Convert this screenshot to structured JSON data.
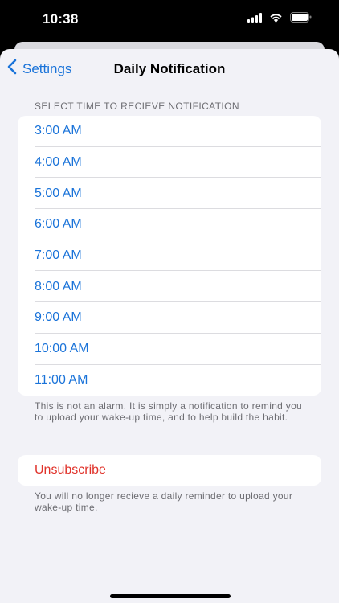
{
  "status_bar": {
    "time": "10:38",
    "icons": [
      "signal-icon",
      "wifi-icon",
      "battery-icon"
    ]
  },
  "nav": {
    "back_label": "Settings",
    "title": "Daily Notification"
  },
  "section_header": "SELECT TIME TO RECIEVE NOTIFICATION",
  "times": [
    "3:00 AM",
    "4:00 AM",
    "5:00 AM",
    "6:00 AM",
    "7:00 AM",
    "8:00 AM",
    "9:00 AM",
    "10:00 AM",
    "11:00 AM"
  ],
  "times_footer": "This is not an alarm. It is simply a notification to remind you to upload your wake-up time, and to help build the habit.",
  "unsubscribe_label": "Unsubscribe",
  "unsubscribe_footer": "You will no longer recieve a daily reminder to upload your wake-up time.",
  "colors": {
    "accent": "#1a73d9",
    "destructive": "#e0322a",
    "background": "#f2f2f7"
  }
}
